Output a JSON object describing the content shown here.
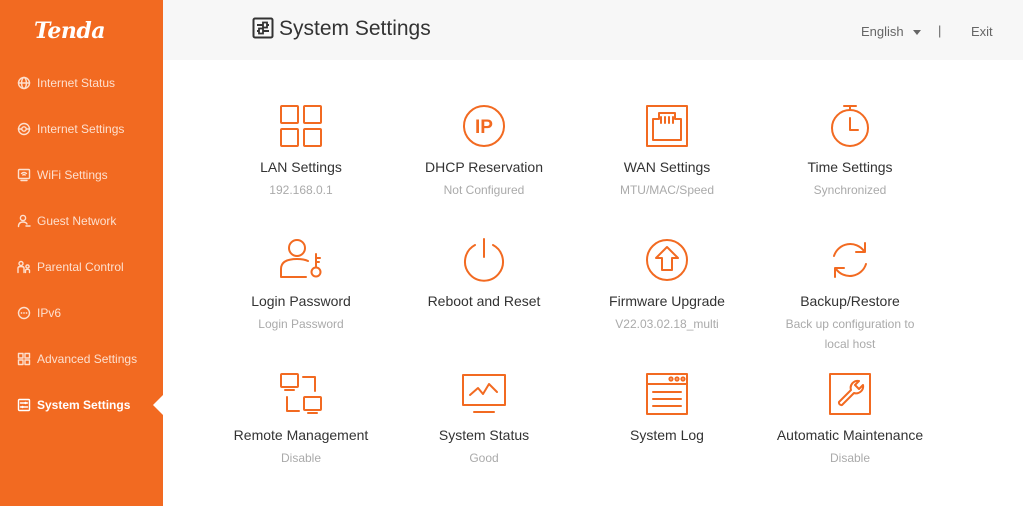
{
  "brand": {
    "logo_text": "Tenda"
  },
  "sidebar": {
    "items": [
      {
        "label": "Internet Status",
        "icon": "globe-icon",
        "active": false
      },
      {
        "label": "Internet Settings",
        "icon": "internet-settings-icon",
        "active": false
      },
      {
        "label": "WiFi Settings",
        "icon": "wifi-settings-icon",
        "active": false
      },
      {
        "label": "Guest Network",
        "icon": "guest-icon",
        "active": false
      },
      {
        "label": "Parental Control",
        "icon": "parental-icon",
        "active": false
      },
      {
        "label": "IPv6",
        "icon": "ipv6-icon",
        "active": false
      },
      {
        "label": "Advanced Settings",
        "icon": "advanced-icon",
        "active": false
      },
      {
        "label": "System Settings",
        "icon": "system-settings-icon",
        "active": true
      }
    ]
  },
  "header": {
    "title": "System Settings",
    "language": "English",
    "separator": "|",
    "exit_label": "Exit"
  },
  "tiles": [
    {
      "title": "LAN Settings",
      "subtitle": "192.168.0.1",
      "icon": "lan-icon"
    },
    {
      "title": "DHCP Reservation",
      "subtitle": "Not Configured",
      "icon": "ip-icon"
    },
    {
      "title": "WAN Settings",
      "subtitle": "MTU/MAC/Speed",
      "icon": "ethernet-port-icon"
    },
    {
      "title": "Time Settings",
      "subtitle": "Synchronized",
      "icon": "stopwatch-icon"
    },
    {
      "title": "Login Password",
      "subtitle": "Login Password",
      "icon": "user-key-icon"
    },
    {
      "title": "Reboot and Reset",
      "subtitle": "",
      "icon": "power-icon"
    },
    {
      "title": "Firmware Upgrade",
      "subtitle": "V22.03.02.18_multi",
      "icon": "upgrade-icon"
    },
    {
      "title": "Backup/Restore",
      "subtitle": "Back up configuration to local host",
      "icon": "sync-icon"
    },
    {
      "title": "Remote Management",
      "subtitle": "Disable",
      "icon": "remote-icon"
    },
    {
      "title": "System Status",
      "subtitle": "Good",
      "icon": "monitor-icon"
    },
    {
      "title": "System Log",
      "subtitle": "",
      "icon": "log-window-icon"
    },
    {
      "title": "Automatic Maintenance",
      "subtitle": "Disable",
      "icon": "wrench-icon"
    }
  ],
  "colors": {
    "accent": "#f26a21",
    "sidebar_text": "#fde0cf",
    "header_bg": "#f7f7f7"
  }
}
